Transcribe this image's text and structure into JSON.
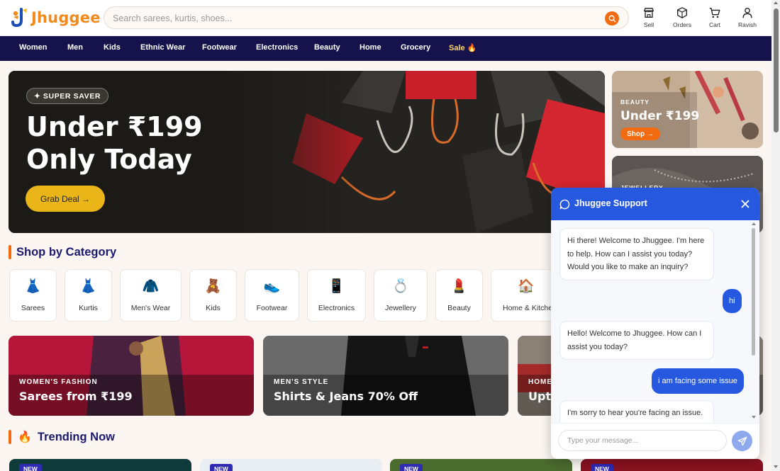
{
  "header": {
    "brand": "Jhuggee",
    "search": {
      "placeholder": "Search sarees, kurtis, shoes...",
      "value": ""
    },
    "nav": [
      {
        "label": "Sell",
        "icon": "store-icon"
      },
      {
        "label": "Orders",
        "icon": "box-icon"
      },
      {
        "label": "Cart",
        "icon": "cart-icon"
      },
      {
        "label": "Ravish",
        "icon": "user-icon"
      }
    ]
  },
  "categories_bar": [
    "Women",
    "Men",
    "Kids",
    "Ethnic Wear",
    "Footwear",
    "Electronics",
    "Beauty",
    "Home",
    "Grocery",
    "Sale 🔥"
  ],
  "hero": {
    "badge": "✦ SUPER SAVER",
    "title_line1": "Under ₹199",
    "title_line2": "Only Today",
    "button": "Grab Deal →"
  },
  "side_cards": [
    {
      "tag": "BEAUTY",
      "heading": "Under ₹199",
      "button": "Shop →"
    },
    {
      "tag": "JEWELLERY"
    }
  ],
  "shop_by_category": {
    "title": "Shop by Category",
    "items": [
      {
        "label": "Sarees",
        "icon": "👗"
      },
      {
        "label": "Kurtis",
        "icon": "👗"
      },
      {
        "label": "Men's Wear",
        "icon": "🧥"
      },
      {
        "label": "Kids",
        "icon": "🧸"
      },
      {
        "label": "Footwear",
        "icon": "👟"
      },
      {
        "label": "Electronics",
        "icon": "📱"
      },
      {
        "label": "Jewellery",
        "icon": "💍"
      },
      {
        "label": "Beauty",
        "icon": "💄"
      },
      {
        "label": "Home & Kitchen",
        "icon": "🏠"
      }
    ]
  },
  "promos": [
    {
      "tag": "WOMEN'S FASHION",
      "heading": "Sarees from ₹199"
    },
    {
      "tag": "MEN'S STYLE",
      "heading": "Shirts & Jeans 70% Off"
    },
    {
      "tag": "HOME",
      "heading": "Upto"
    }
  ],
  "trending": {
    "title": "Trending Now",
    "icon": "🔥",
    "badges": [
      "NEW",
      "NEW",
      "NEW",
      "NEW"
    ]
  },
  "chat": {
    "title": "Jhuggee Support",
    "messages": [
      {
        "from": "bot",
        "text": "Hi there! Welcome to Jhuggee. I'm here to help. How can I assist you today? Would you like to make an inquiry?"
      },
      {
        "from": "user",
        "text": "hi"
      },
      {
        "from": "bot",
        "text": "Hello! Welcome to Jhuggee. How can I assist you today?"
      },
      {
        "from": "user",
        "text": "i am facing some issue"
      },
      {
        "from": "bot",
        "text": "I'm sorry to hear you're facing an issue. I"
      }
    ],
    "input_placeholder": "Type your message..."
  },
  "colors": {
    "accent": "#f26b10",
    "navy": "#16124b",
    "chat_blue": "#2759e0",
    "deal_yellow": "#e9b519"
  }
}
